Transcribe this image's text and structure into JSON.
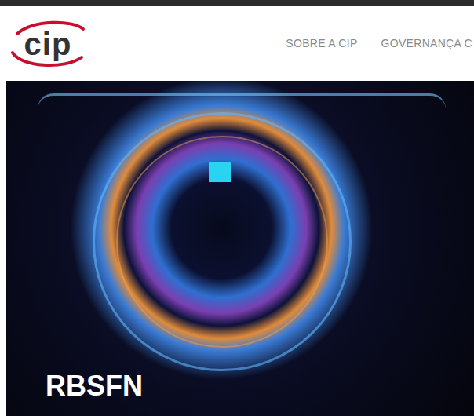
{
  "logo": {
    "text": "cip"
  },
  "nav": [
    {
      "label": "SOBRE A CIP"
    },
    {
      "label": "GOVERNANÇA C"
    }
  ],
  "hero": {
    "title": "RBSFN"
  }
}
